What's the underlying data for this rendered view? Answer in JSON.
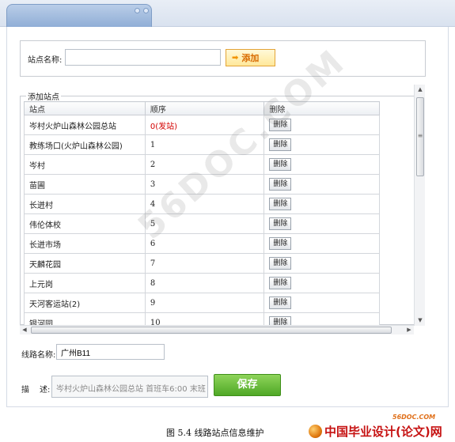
{
  "station_form": {
    "name_label": "站点名称:",
    "name_value": "",
    "add_label": "添加",
    "add_arrow": "➡"
  },
  "station_list": {
    "legend": "添加站点",
    "headers": [
      "站点",
      "顺序",
      "删除"
    ],
    "delete_label": "删除",
    "rows": [
      {
        "station": "岑村火炉山森林公园总站",
        "order": "0(发站)"
      },
      {
        "station": "教练场口(火炉山森林公园)",
        "order": "1"
      },
      {
        "station": "岑村",
        "order": "2"
      },
      {
        "station": "苗圃",
        "order": "3"
      },
      {
        "station": "长迸村",
        "order": "4"
      },
      {
        "station": "伟伦体校",
        "order": "5"
      },
      {
        "station": "长迸市场",
        "order": "6"
      },
      {
        "station": "天麟花园",
        "order": "7"
      },
      {
        "station": "上元岗",
        "order": "8"
      },
      {
        "station": "天河客运站(2)",
        "order": "9"
      },
      {
        "station": "银河园",
        "order": "10"
      }
    ]
  },
  "route": {
    "label": "线路名称:",
    "value": "广州B11"
  },
  "description": {
    "label_a": "描",
    "label_b": "述:",
    "value": "岑村火炉山森林公园总站  首班车6:00 末班"
  },
  "save_label": "保存",
  "caption": "图 5.4 线路站点信息维护",
  "watermark": "56DOC.COM",
  "logo": {
    "text": "中国毕业设计(论文)网",
    "url": "56DOC.COM"
  },
  "colors": {
    "add_text": "#d86b00",
    "start_order": "#d40000",
    "save_button": "#4fa826",
    "logo_red": "#c61212"
  }
}
